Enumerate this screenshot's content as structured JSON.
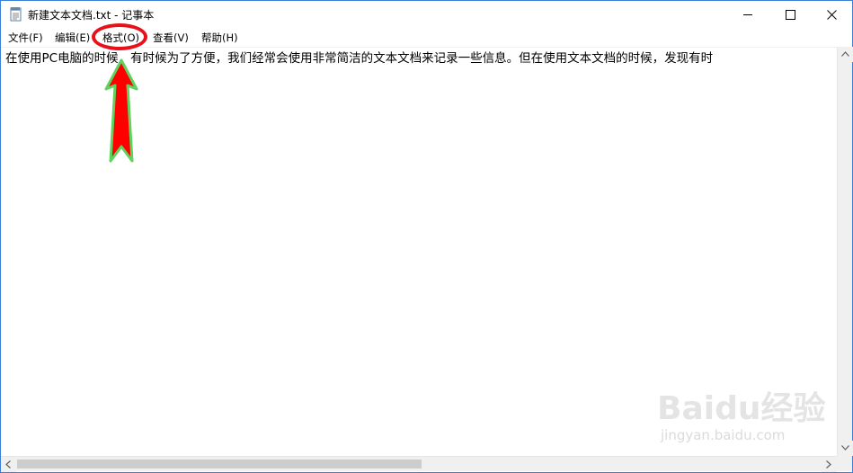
{
  "window": {
    "title": "新建文本文档.txt - 记事本",
    "app_icon": "notepad-icon",
    "controls": {
      "minimize_icon": "minimize-icon",
      "maximize_icon": "maximize-icon",
      "close_icon": "close-icon"
    }
  },
  "menu": {
    "items": [
      {
        "label": "文件(F)"
      },
      {
        "label": "编辑(E)"
      },
      {
        "label": "格式(O)"
      },
      {
        "label": "查看(V)"
      },
      {
        "label": "帮助(H)"
      }
    ]
  },
  "editor": {
    "content": "在使用PC电脑的时候，有时候为了方便，我们经常会使用非常简洁的文本文档来记录一些信息。但在使用文本文档的时候，发现有时"
  },
  "annotation": {
    "highlight_color": "#e8111b",
    "arrow_color": "#ff0000",
    "arrow_outline_color": "#5fd35f"
  },
  "watermark": {
    "brand": "Baidu经验",
    "url": "jingyan.baidu.com"
  },
  "colors": {
    "window_border": "#3b7fd8",
    "scrollbar_bg": "#f0f0f0",
    "scrollbar_thumb": "#cdcdcd"
  }
}
